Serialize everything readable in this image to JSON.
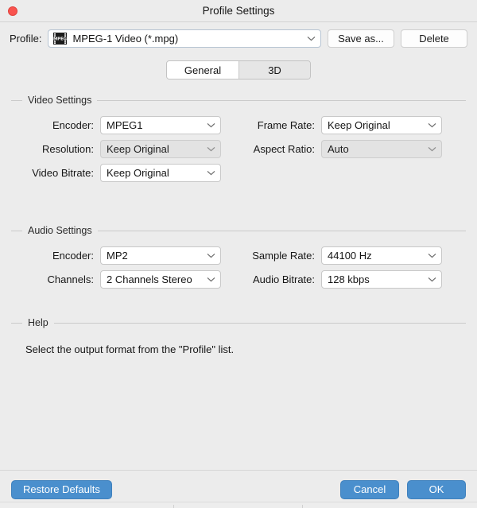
{
  "window": {
    "title": "Profile Settings",
    "close_icon": "close-icon"
  },
  "profile_bar": {
    "label": "Profile:",
    "icon": "mpeg-film-icon",
    "value": "MPEG-1 Video (*.mpg)",
    "dropdown_icon": "chevron-down-icon",
    "save_as_label": "Save as...",
    "delete_label": "Delete"
  },
  "tabs": [
    {
      "label": "General",
      "selected": true
    },
    {
      "label": "3D",
      "selected": false
    }
  ],
  "video_settings": {
    "title": "Video Settings",
    "fields": [
      {
        "label": "Encoder:",
        "value": "MPEG1",
        "disabled": false
      },
      {
        "label": "Frame Rate:",
        "value": "Keep Original",
        "disabled": false
      },
      {
        "label": "Resolution:",
        "value": "Keep Original",
        "disabled": true
      },
      {
        "label": "Aspect Ratio:",
        "value": "Auto",
        "disabled": true
      },
      {
        "label": "Video Bitrate:",
        "value": "Keep Original",
        "disabled": false
      }
    ]
  },
  "audio_settings": {
    "title": "Audio Settings",
    "fields": [
      {
        "label": "Encoder:",
        "value": "MP2",
        "disabled": false
      },
      {
        "label": "Sample Rate:",
        "value": "44100 Hz",
        "disabled": false
      },
      {
        "label": "Channels:",
        "value": "2 Channels Stereo",
        "disabled": false
      },
      {
        "label": "Audio Bitrate:",
        "value": "128 kbps",
        "disabled": false
      }
    ]
  },
  "help": {
    "title": "Help",
    "text": "Select the output format from the \"Profile\" list."
  },
  "footer": {
    "restore_defaults_label": "Restore Defaults",
    "cancel_label": "Cancel",
    "ok_label": "OK"
  },
  "colors": {
    "window_background": "#ececec",
    "accent_blue": "#4a8fcd",
    "close_red": "#f9534e",
    "field_white": "#ffffff",
    "field_disabled": "#e3e3e3"
  }
}
